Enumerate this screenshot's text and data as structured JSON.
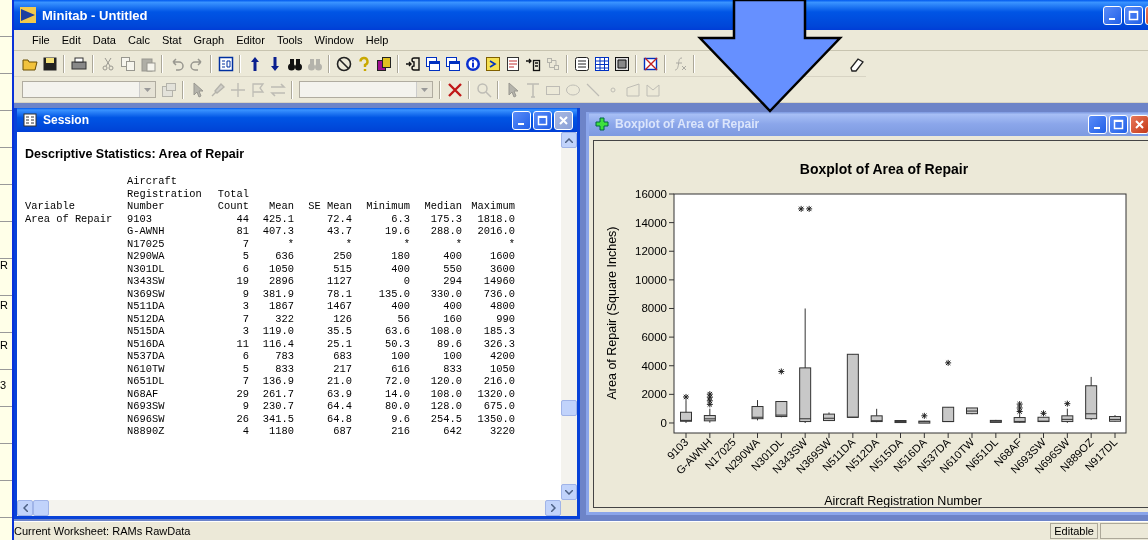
{
  "background_sheet": {
    "fragments": [
      "R",
      "R",
      "R",
      "3"
    ]
  },
  "window": {
    "title": "Minitab - Untitled"
  },
  "menu": [
    "File",
    "Edit",
    "Data",
    "Calc",
    "Stat",
    "Graph",
    "Editor",
    "Tools",
    "Window",
    "Help"
  ],
  "toolbars": [
    [
      {
        "kind": "folder",
        "disabled": false
      },
      {
        "kind": "disk",
        "disabled": false
      },
      {
        "kind": "separator"
      },
      {
        "kind": "printer",
        "disabled": false
      },
      {
        "kind": "separator"
      },
      {
        "kind": "scissors",
        "disabled": true
      },
      {
        "kind": "copy",
        "disabled": true
      },
      {
        "kind": "clipboard",
        "disabled": true
      },
      {
        "kind": "separator"
      },
      {
        "kind": "undo",
        "disabled": true
      },
      {
        "kind": "redo",
        "disabled": true
      },
      {
        "kind": "separator"
      },
      {
        "kind": "window",
        "disabled": false
      },
      {
        "kind": "separator"
      },
      {
        "kind": "up",
        "disabled": false
      },
      {
        "kind": "down",
        "disabled": false
      },
      {
        "kind": "binoculars",
        "disabled": false
      },
      {
        "kind": "replace",
        "disabled": true
      },
      {
        "kind": "separator"
      },
      {
        "kind": "nosign",
        "disabled": false
      },
      {
        "kind": "question",
        "disabled": false
      },
      {
        "kind": "stack",
        "disabled": false
      },
      {
        "kind": "separator"
      },
      {
        "kind": "insert",
        "disabled": false
      },
      {
        "kind": "windows",
        "disabled": false
      },
      {
        "kind": "windows",
        "disabled": false
      },
      {
        "kind": "info",
        "disabled": false
      },
      {
        "kind": "prompt",
        "disabled": false
      },
      {
        "kind": "notepad",
        "disabled": false
      },
      {
        "kind": "append",
        "disabled": false
      },
      {
        "kind": "nodes",
        "disabled": true
      },
      {
        "kind": "separator"
      },
      {
        "kind": "layout",
        "disabled": false
      },
      {
        "kind": "grid",
        "disabled": false
      },
      {
        "kind": "table",
        "disabled": false
      },
      {
        "kind": "separator"
      },
      {
        "kind": "crossed",
        "disabled": false
      },
      {
        "kind": "separator"
      },
      {
        "kind": "function",
        "disabled": true
      },
      {
        "kind": "separator"
      },
      {
        "kind": "eraser",
        "disabled": false
      }
    ],
    [
      {
        "kind": "combo",
        "disabled": true
      },
      {
        "kind": "properties",
        "disabled": true
      },
      {
        "kind": "separator"
      },
      {
        "kind": "pointer",
        "disabled": true
      },
      {
        "kind": "brush",
        "disabled": true
      },
      {
        "kind": "crosshair",
        "disabled": true
      },
      {
        "kind": "flag",
        "disabled": true
      },
      {
        "kind": "swap",
        "disabled": true
      },
      {
        "kind": "separator"
      },
      {
        "kind": "combo",
        "disabled": true
      },
      {
        "kind": "separator"
      },
      {
        "kind": "cross",
        "disabled": false
      },
      {
        "kind": "separator"
      },
      {
        "kind": "magnifier",
        "disabled": true
      },
      {
        "kind": "separator"
      },
      {
        "kind": "pointer",
        "disabled": true
      },
      {
        "kind": "texttool",
        "disabled": true
      },
      {
        "kind": "rectangle",
        "disabled": true
      },
      {
        "kind": "ellipse",
        "disabled": true
      },
      {
        "kind": "line",
        "disabled": true
      },
      {
        "kind": "dot",
        "disabled": true
      },
      {
        "kind": "polygon",
        "disabled": true
      },
      {
        "kind": "polyline",
        "disabled": true
      }
    ]
  ],
  "session": {
    "title": "Session",
    "active": true,
    "heading": "Descriptive Statistics: Area of Repair",
    "columns": [
      {
        "header": [
          "Variable"
        ]
      },
      {
        "header": [
          "Aircraft",
          "Registration",
          "Number"
        ]
      },
      {
        "header": [
          "Total",
          "Count"
        ]
      },
      {
        "header": [
          "Mean"
        ]
      },
      {
        "header": [
          "SE Mean"
        ]
      },
      {
        "header": [
          "Minimum"
        ]
      },
      {
        "header": [
          "Median"
        ]
      },
      {
        "header": [
          "Maximum"
        ]
      }
    ],
    "rows": [
      [
        "Area of Repair",
        "9103",
        "44",
        "425.1",
        "72.4",
        "6.3",
        "175.3",
        "1818.0"
      ],
      [
        "",
        "G-AWNH",
        "81",
        "407.3",
        "43.7",
        "19.6",
        "288.0",
        "2016.0"
      ],
      [
        "",
        "N17025",
        "7",
        "*",
        "*",
        "*",
        "*",
        "*"
      ],
      [
        "",
        "N290WA",
        "5",
        "636",
        "250",
        "180",
        "400",
        "1600"
      ],
      [
        "",
        "N301DL",
        "6",
        "1050",
        "515",
        "400",
        "550",
        "3600"
      ],
      [
        "",
        "N343SW",
        "19",
        "2896",
        "1127",
        "0",
        "294",
        "14960"
      ],
      [
        "",
        "N369SW",
        "9",
        "381.9",
        "78.1",
        "135.0",
        "330.0",
        "736.0"
      ],
      [
        "",
        "N511DA",
        "3",
        "1867",
        "1467",
        "400",
        "400",
        "4800"
      ],
      [
        "",
        "N512DA",
        "7",
        "322",
        "126",
        "56",
        "160",
        "990"
      ],
      [
        "",
        "N515DA",
        "3",
        "119.0",
        "35.5",
        "63.6",
        "108.0",
        "185.3"
      ],
      [
        "",
        "N516DA",
        "11",
        "116.4",
        "25.1",
        "50.3",
        "89.6",
        "326.3"
      ],
      [
        "",
        "N537DA",
        "6",
        "783",
        "683",
        "100",
        "100",
        "4200"
      ],
      [
        "",
        "N610TW",
        "5",
        "833",
        "217",
        "616",
        "833",
        "1050"
      ],
      [
        "",
        "N651DL",
        "7",
        "136.9",
        "21.0",
        "72.0",
        "120.0",
        "216.0"
      ],
      [
        "",
        "N68AF",
        "29",
        "261.7",
        "63.9",
        "14.0",
        "108.0",
        "1320.0"
      ],
      [
        "",
        "N693SW",
        "9",
        "230.7",
        "64.4",
        "80.0",
        "128.0",
        "675.0"
      ],
      [
        "",
        "N696SW",
        "26",
        "341.5",
        "64.8",
        "9.6",
        "254.5",
        "1350.0"
      ],
      [
        "",
        "N8890Z",
        "4",
        "1180",
        "687",
        "216",
        "642",
        "3220"
      ]
    ]
  },
  "graph_window": {
    "title": "Boxplot of Area of Repair",
    "active": false,
    "chart_data": {
      "type": "box",
      "title": "Boxplot of Area of Repair",
      "xlabel": "Aircraft Registration Number",
      "ylabel": "Area of Repair (Square Inches)",
      "ylim": [
        -700,
        16000
      ],
      "yticks": [
        0,
        2000,
        4000,
        6000,
        8000,
        10000,
        12000,
        14000,
        16000
      ],
      "categories": [
        "9103",
        "G-AWNH",
        "N17025",
        "N290WA",
        "N301DL",
        "N343SW",
        "N369SW",
        "N511DA",
        "N512DA",
        "N515DA",
        "N516DA",
        "N537DA",
        "N610TW",
        "N651DL",
        "N68AF",
        "N693SW",
        "N696SW",
        "N889OZ",
        "N917DL"
      ],
      "boxes": [
        {
          "low": 6,
          "q1": 120,
          "median": 180,
          "q3": 750,
          "high": 1600,
          "outliers": [
            1818
          ]
        },
        {
          "low": 20,
          "q1": 150,
          "median": 290,
          "q3": 520,
          "high": 1000,
          "outliers": [
            1300,
            1550,
            1800,
            2016
          ]
        },
        null,
        {
          "low": 180,
          "q1": 300,
          "median": 400,
          "q3": 1150,
          "high": 1600
        },
        {
          "low": 400,
          "q1": 450,
          "median": 550,
          "q3": 1500,
          "high": 1500,
          "outliers": [
            3600
          ]
        },
        {
          "low": 0,
          "q1": 100,
          "median": 294,
          "q3": 3850,
          "high": 8000,
          "outliers": [
            14960,
            14960
          ]
        },
        {
          "low": 135,
          "q1": 170,
          "median": 330,
          "q3": 620,
          "high": 736
        },
        {
          "low": 400,
          "q1": 400,
          "median": 400,
          "q3": 4800,
          "high": 4800
        },
        {
          "low": 56,
          "q1": 100,
          "median": 160,
          "q3": 500,
          "high": 990
        },
        {
          "low": 64,
          "q1": 70,
          "median": 108,
          "q3": 170,
          "high": 185
        },
        {
          "low": 50,
          "q1": 60,
          "median": 90,
          "q3": 130,
          "high": 150,
          "outliers": [
            500
          ]
        },
        {
          "low": 100,
          "q1": 100,
          "median": 100,
          "q3": 1100,
          "high": 1100,
          "outliers": [
            4200
          ]
        },
        {
          "low": 616,
          "q1": 650,
          "median": 833,
          "q3": 1050,
          "high": 1050
        },
        {
          "low": 72,
          "q1": 90,
          "median": 120,
          "q3": 180,
          "high": 216
        },
        {
          "low": 14,
          "q1": 50,
          "median": 108,
          "q3": 380,
          "high": 600,
          "outliers": [
            800,
            1050,
            1320
          ]
        },
        {
          "low": 80,
          "q1": 100,
          "median": 128,
          "q3": 400,
          "high": 400,
          "outliers": [
            675
          ]
        },
        {
          "low": 10,
          "q1": 100,
          "median": 254,
          "q3": 500,
          "high": 1000,
          "outliers": [
            1350
          ]
        },
        {
          "low": 216,
          "q1": 300,
          "median": 642,
          "q3": 2600,
          "high": 3220
        },
        {
          "low": 100,
          "q1": 120,
          "median": 250,
          "q3": 450,
          "high": 550
        }
      ]
    }
  },
  "status_bar": {
    "text": "Current Worksheet: RAMs RawData",
    "panels": [
      "Editable"
    ]
  }
}
